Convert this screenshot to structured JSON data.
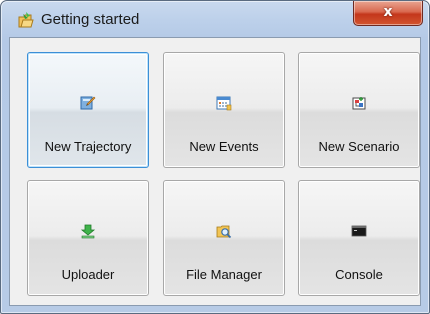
{
  "window": {
    "title": "Getting started",
    "close_symbol": "x",
    "title_icon": "getting-started-icon"
  },
  "tiles": [
    {
      "label": "New Trajectory",
      "icon": "new-trajectory-icon",
      "selected": true
    },
    {
      "label": "New Events",
      "icon": "new-events-icon",
      "selected": false
    },
    {
      "label": "New Scenario",
      "icon": "new-scenario-icon",
      "selected": false
    },
    {
      "label": "Uploader",
      "icon": "uploader-icon",
      "selected": false
    },
    {
      "label": "File Manager",
      "icon": "file-manager-icon",
      "selected": false
    },
    {
      "label": "Console",
      "icon": "console-icon",
      "selected": false
    }
  ],
  "colors": {
    "selection_border": "#3c8fd6",
    "close_button": "#c4371c"
  }
}
